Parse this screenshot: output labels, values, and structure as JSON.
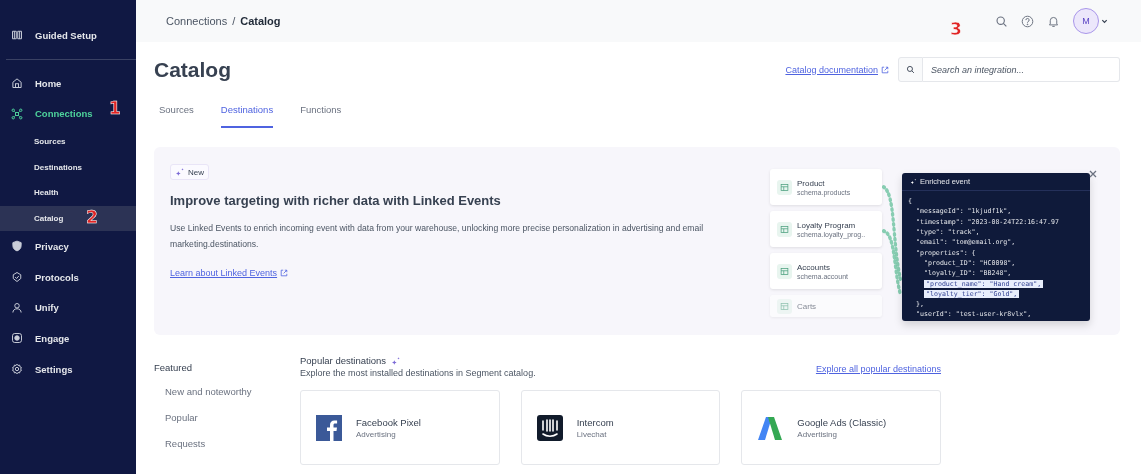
{
  "sidebar": {
    "items": [
      {
        "label": "Guided Setup",
        "selected": false,
        "active": false
      },
      {
        "label": "Home",
        "selected": false,
        "active": false
      },
      {
        "label": "Connections",
        "selected": false,
        "active": true,
        "callout": "1",
        "children": [
          {
            "label": "Sources",
            "selected": false
          },
          {
            "label": "Destinations",
            "selected": false
          },
          {
            "label": "Health",
            "selected": false
          },
          {
            "label": "Catalog",
            "selected": true,
            "callout": "2"
          }
        ]
      },
      {
        "label": "Privacy",
        "selected": false,
        "active": false
      },
      {
        "label": "Protocols",
        "selected": false,
        "active": false
      },
      {
        "label": "Unify",
        "selected": false,
        "active": false
      },
      {
        "label": "Engage",
        "selected": false,
        "active": false
      },
      {
        "label": "Settings",
        "selected": false,
        "active": false
      }
    ]
  },
  "breadcrumb": [
    "Connections",
    "/",
    "Catalog"
  ],
  "user": {
    "initial": "M"
  },
  "page": {
    "title": "Catalog",
    "doc_link": "Catalog documentation",
    "search": {
      "placeholder": "Search an integration...",
      "callout": "3"
    }
  },
  "tabs": [
    {
      "label": "Sources",
      "selected": false
    },
    {
      "label": "Destinations",
      "selected": true
    },
    {
      "label": "Functions",
      "selected": false
    }
  ],
  "banner": {
    "badge": "New",
    "title": "Improve targeting with richer data with Linked Events",
    "text": "Use Linked Events to enrich incoming event with data from your warehouse, unlocking more precise personalization in advertising and email marketing.destinations.",
    "link": "Learn about Linked Events",
    "tables": [
      {
        "name": "Product",
        "schema": "schema.products",
        "faded": false
      },
      {
        "name": "Loyalty Program",
        "schema": "schema.loyalty_prog..",
        "faded": false
      },
      {
        "name": "Accounts",
        "schema": "schema.account",
        "faded": false
      },
      {
        "name": "Carts",
        "faded": true
      }
    ],
    "event_title": "Enriched event",
    "code": [
      {
        "text": "{",
        "highlight": false,
        "children": [
          {
            "text": "\"messageId\": \"1kjudf1k\",",
            "highlight": false
          },
          {
            "text": "\"timestamp\": \"2023-08-24T22:16:47.97",
            "highlight": false
          },
          {
            "text": "\"type\": \"track\",",
            "highlight": false
          },
          {
            "text": "\"email\": \"tom@email.org\",",
            "highlight": false
          },
          {
            "text": "\"properties\": {",
            "highlight": false,
            "children": [
              {
                "text": "\"product_ID\": \"HC0098\",",
                "highlight": false
              },
              {
                "text": "\"loyalty_ID\": \"BB248\",",
                "highlight": false
              },
              {
                "text": "\"product_name\": \"Hand cream\",",
                "highlight": true
              },
              {
                "text": "\"loyalty_tier\": \"Gold\",",
                "highlight": true
              }
            ]
          },
          {
            "text": "},",
            "highlight": false
          },
          {
            "text": "\"userId\": \"test-user-kr8vlx\",",
            "highlight": false
          }
        ]
      }
    ]
  },
  "featured": {
    "heading": "Featured",
    "items": [
      "New and noteworthy",
      "Popular",
      "Requests"
    ]
  },
  "popular": {
    "title": "Popular destinations",
    "subtitle": "Explore the most installed destinations in Segment catalog.",
    "link": "Explore all popular destinations",
    "cards": [
      {
        "name": "Facebook Pixel",
        "category": "Advertising",
        "kind": "facebook"
      },
      {
        "name": "Intercom",
        "category": "Livechat",
        "kind": "intercom"
      },
      {
        "name": "Google Ads (Classic)",
        "category": "Advertising",
        "kind": "googleads"
      }
    ]
  }
}
